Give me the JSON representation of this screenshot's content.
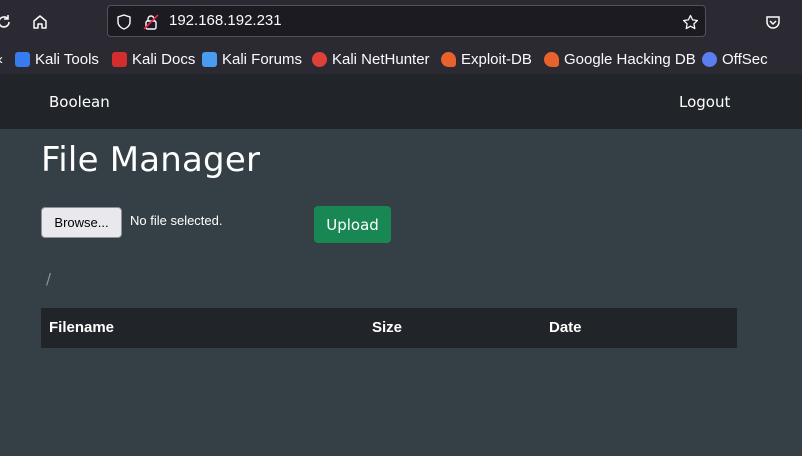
{
  "browser": {
    "url": "192.168.192.231",
    "bookmarks": [
      {
        "label": "Kali Tools",
        "icon": "kali-tools-icon",
        "color": "#367bf0"
      },
      {
        "label": "Kali Docs",
        "icon": "kali-docs-icon",
        "color": "#d32d2d"
      },
      {
        "label": "Kali Forums",
        "icon": "kali-forums-icon",
        "color": "#4a9cf0"
      },
      {
        "label": "Kali NetHunter",
        "icon": "kali-nethunter-icon",
        "color": "#e0403a"
      },
      {
        "label": "Exploit-DB",
        "icon": "exploit-db-icon",
        "color": "#e8622c"
      },
      {
        "label": "Google Hacking DB",
        "icon": "ghdb-icon",
        "color": "#e8622c"
      },
      {
        "label": "OffSec",
        "icon": "offsec-icon",
        "color": "#5a7df0"
      }
    ]
  },
  "navbar": {
    "brand": "Boolean",
    "logout": "Logout"
  },
  "main": {
    "title": "File Manager",
    "browse_label": "Browse...",
    "file_status": "No file selected.",
    "upload_label": "Upload",
    "path": "/",
    "table": {
      "columns": [
        "Filename",
        "Size",
        "Date"
      ],
      "rows": []
    }
  },
  "colors": {
    "page_bg": "#343f46",
    "navbar_bg": "#212529",
    "upload_bg": "#198754"
  }
}
